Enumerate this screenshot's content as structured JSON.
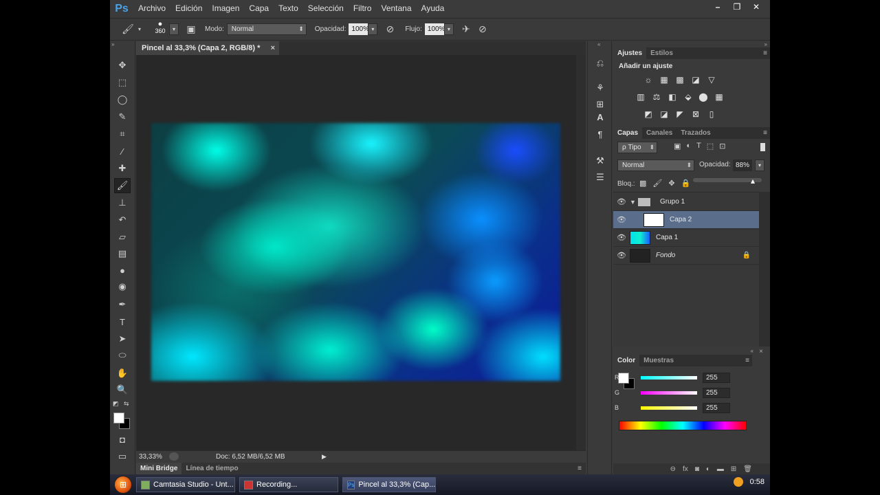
{
  "menubar": {
    "logo": "Ps",
    "items": [
      "Archivo",
      "Edición",
      "Imagen",
      "Capa",
      "Texto",
      "Selección",
      "Filtro",
      "Ventana",
      "Ayuda"
    ],
    "window_controls": [
      "–",
      "❐",
      "✕"
    ]
  },
  "options": {
    "brush_size": "360",
    "mode_label": "Modo:",
    "mode_value": "Normal",
    "opacity_label": "Opacidad:",
    "opacity_value": "100%",
    "flow_label": "Flujo:",
    "flow_value": "100%"
  },
  "document": {
    "tab_title": "Pincel al 33,3% (Capa 2, RGB/8) *",
    "tab_close": "×",
    "zoom": "33,33%",
    "doc_info": "Doc: 6,52 MB/6,52 MB",
    "bottom_tabs": [
      "Mini Bridge",
      "Línea de tiempo"
    ]
  },
  "adjustments": {
    "tabs": [
      "Ajustes",
      "Estilos"
    ],
    "heading": "Añadir un ajuste",
    "icon_names": [
      "brightness-icon",
      "levels-icon",
      "curves-icon",
      "exposure-icon",
      "vibrance-icon",
      "hue-saturation-icon",
      "color-balance-icon",
      "black-white-icon",
      "photo-filter-icon",
      "channel-mixer-icon",
      "color-lookup-icon",
      "invert-icon",
      "posterize-icon",
      "threshold-icon",
      "gradient-map-icon",
      "selective-color-icon"
    ]
  },
  "layers": {
    "tabs": [
      "Capas",
      "Canales",
      "Trazados"
    ],
    "filter_label": "ρ Tipo",
    "blend_mode": "Normal",
    "opacity_label": "Opacidad:",
    "opacity_value": "88%",
    "lock_label": "Bloq.:",
    "items": [
      {
        "name": "Grupo 1",
        "type": "group"
      },
      {
        "name": "Capa 2",
        "type": "layer",
        "selected": true
      },
      {
        "name": "Capa 1",
        "type": "layer"
      },
      {
        "name": "Fondo",
        "type": "background"
      }
    ]
  },
  "color_panel": {
    "tabs": [
      "Color",
      "Muestras"
    ],
    "channels": [
      {
        "label": "R",
        "value": "255",
        "gradient": "linear-gradient(90deg,#00ffff,#ffffff)"
      },
      {
        "label": "G",
        "value": "255",
        "gradient": "linear-gradient(90deg,#ff00ff,#ffffff)"
      },
      {
        "label": "B",
        "value": "255",
        "gradient": "linear-gradient(90deg,#ffff00,#ffffff)"
      }
    ]
  },
  "taskbar": {
    "items": [
      {
        "label": "Camtasia Studio - Unt..."
      },
      {
        "label": "Recording..."
      },
      {
        "label": "Pincel al 33,3% (Cap...",
        "active": true
      }
    ],
    "clock": "0:58"
  }
}
